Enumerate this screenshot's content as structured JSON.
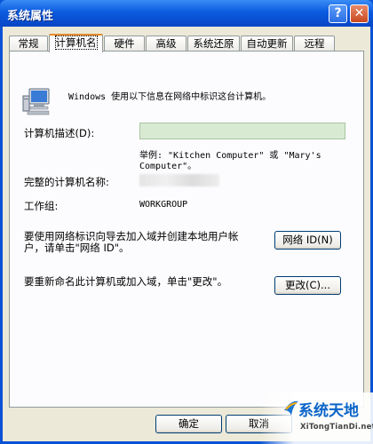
{
  "window": {
    "title": "系统属性"
  },
  "titlebar_buttons": {
    "help": "?",
    "close": "✕"
  },
  "tabs": [
    {
      "label": "常规"
    },
    {
      "label": "计算机名"
    },
    {
      "label": "硬件"
    },
    {
      "label": "高级"
    },
    {
      "label": "系统还原"
    },
    {
      "label": "自动更新"
    },
    {
      "label": "远程"
    }
  ],
  "panel": {
    "intro": "Windows 使用以下信息在网络中标识这台计算机。",
    "description_label": "计算机描述(D):",
    "description_value": "",
    "example_line1": "举例: \"Kitchen Computer\" 或 \"Mary's",
    "example_line2": "Computer\"。",
    "full_name_label": "完整的计算机名称:",
    "workgroup_label": "工作组:",
    "workgroup_value": "WORKGROUP",
    "network_text_line1": "要使用网络标识向导去加入域并创建本地用户帐",
    "network_text_line2": "户，请单击\"网络 ID\"。",
    "network_id_button": "网络 ID(N)",
    "rename_text": "要重新命名此计算机或加入域，单击\"更改\"。",
    "change_button": "更改(C)..."
  },
  "footer": {
    "ok_button": "确定",
    "cancel_button": "取消"
  },
  "watermark": {
    "title": "系统天地",
    "url": "XiTongTianDi.net"
  }
}
